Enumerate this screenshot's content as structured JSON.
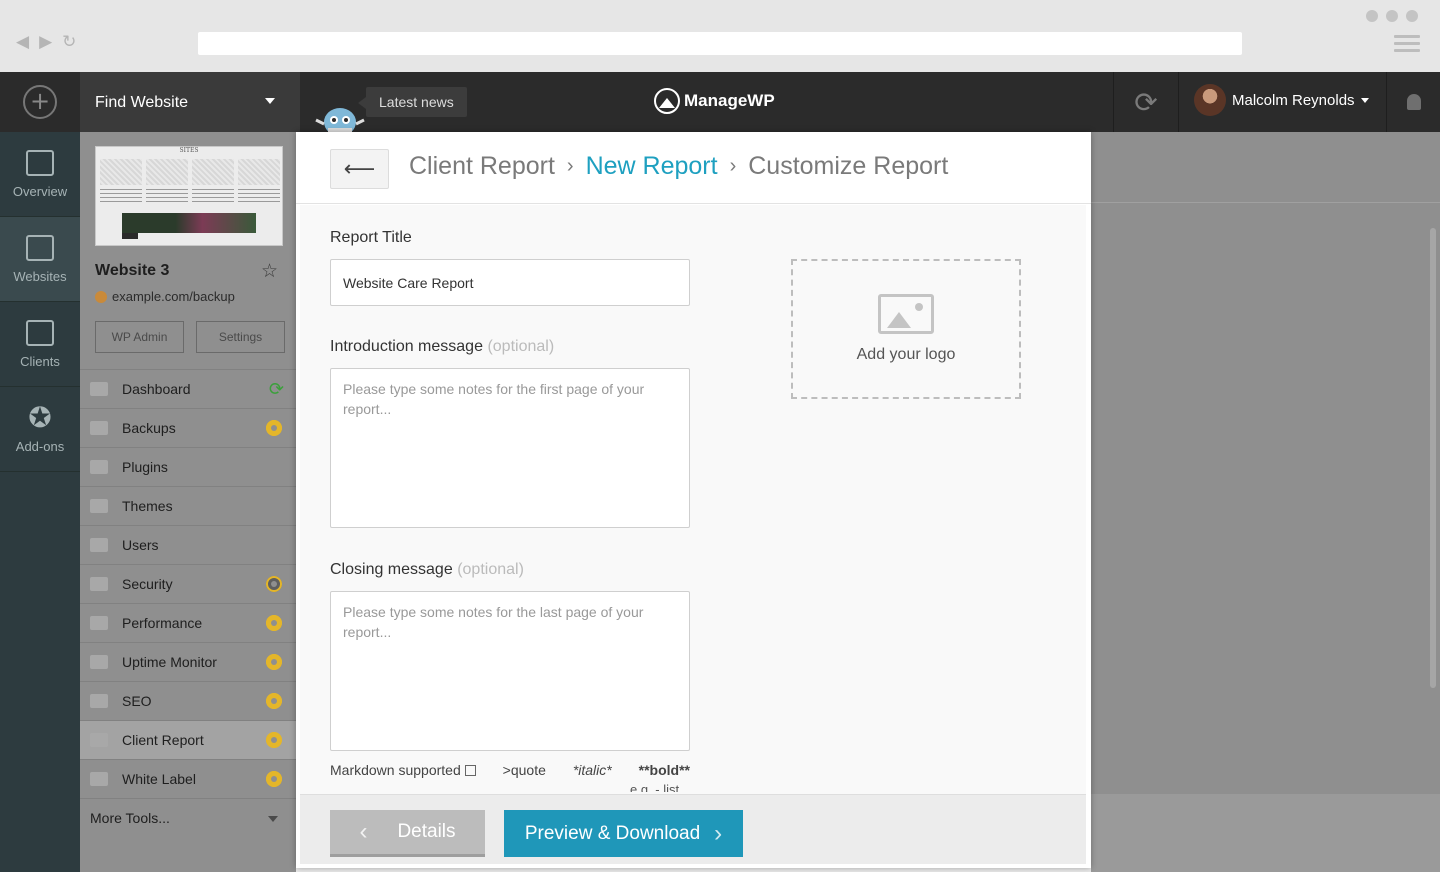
{
  "topbar": {
    "find_website": "Find Website",
    "latest_news": "Latest news",
    "logo_text": "ManageWP",
    "user_name": "Malcolm Reynolds"
  },
  "rail": {
    "items": [
      {
        "label": "Overview",
        "icon": "chart-icon"
      },
      {
        "label": "Websites",
        "icon": "websites-icon"
      },
      {
        "label": "Clients",
        "icon": "clients-icon"
      },
      {
        "label": "Add-ons",
        "icon": "star-badge-icon"
      }
    ]
  },
  "website": {
    "thumb_title": "SITES",
    "name": "Website 3",
    "url": "example.com/backup",
    "wp_admin": "WP Admin",
    "settings": "Settings",
    "menu": [
      {
        "label": "Dashboard",
        "badge": "sync"
      },
      {
        "label": "Backups",
        "badge": "gear-yellow"
      },
      {
        "label": "Plugins",
        "badge": ""
      },
      {
        "label": "Themes",
        "badge": ""
      },
      {
        "label": "Users",
        "badge": ""
      },
      {
        "label": "Security",
        "badge": "gear-grey"
      },
      {
        "label": "Performance",
        "badge": "gear-yellow"
      },
      {
        "label": "Uptime Monitor",
        "badge": "gear-yellow"
      },
      {
        "label": "SEO",
        "badge": "gear-yellow"
      },
      {
        "label": "Client Report",
        "badge": "gear-yellow",
        "active": true
      },
      {
        "label": "White Label",
        "badge": "gear-yellow"
      }
    ],
    "more_tools": "More Tools..."
  },
  "modal": {
    "breadcrumb": [
      "Client Report",
      "New Report",
      "Customize Report"
    ],
    "report_title_label": "Report Title",
    "report_title_value": "Website Care Report",
    "intro_label": "Introduction message",
    "intro_optional": "(optional)",
    "intro_placeholder": "Please type some notes for the first page of your report...",
    "closing_label": "Closing message",
    "closing_optional": "(optional)",
    "closing_placeholder": "Please type some notes for the last page of your report...",
    "add_logo": "Add your logo",
    "markdown_supported": "Markdown supported",
    "md_quote": ">quote",
    "md_italic": "*italic*",
    "md_bold": "**bold**",
    "md_sub": "e.g. - list",
    "details_button": "Details",
    "preview_button": "Preview & Download"
  },
  "colors": {
    "accent": "#1f97b9",
    "link": "#1ea0c0",
    "gear": "#e4b62a"
  }
}
